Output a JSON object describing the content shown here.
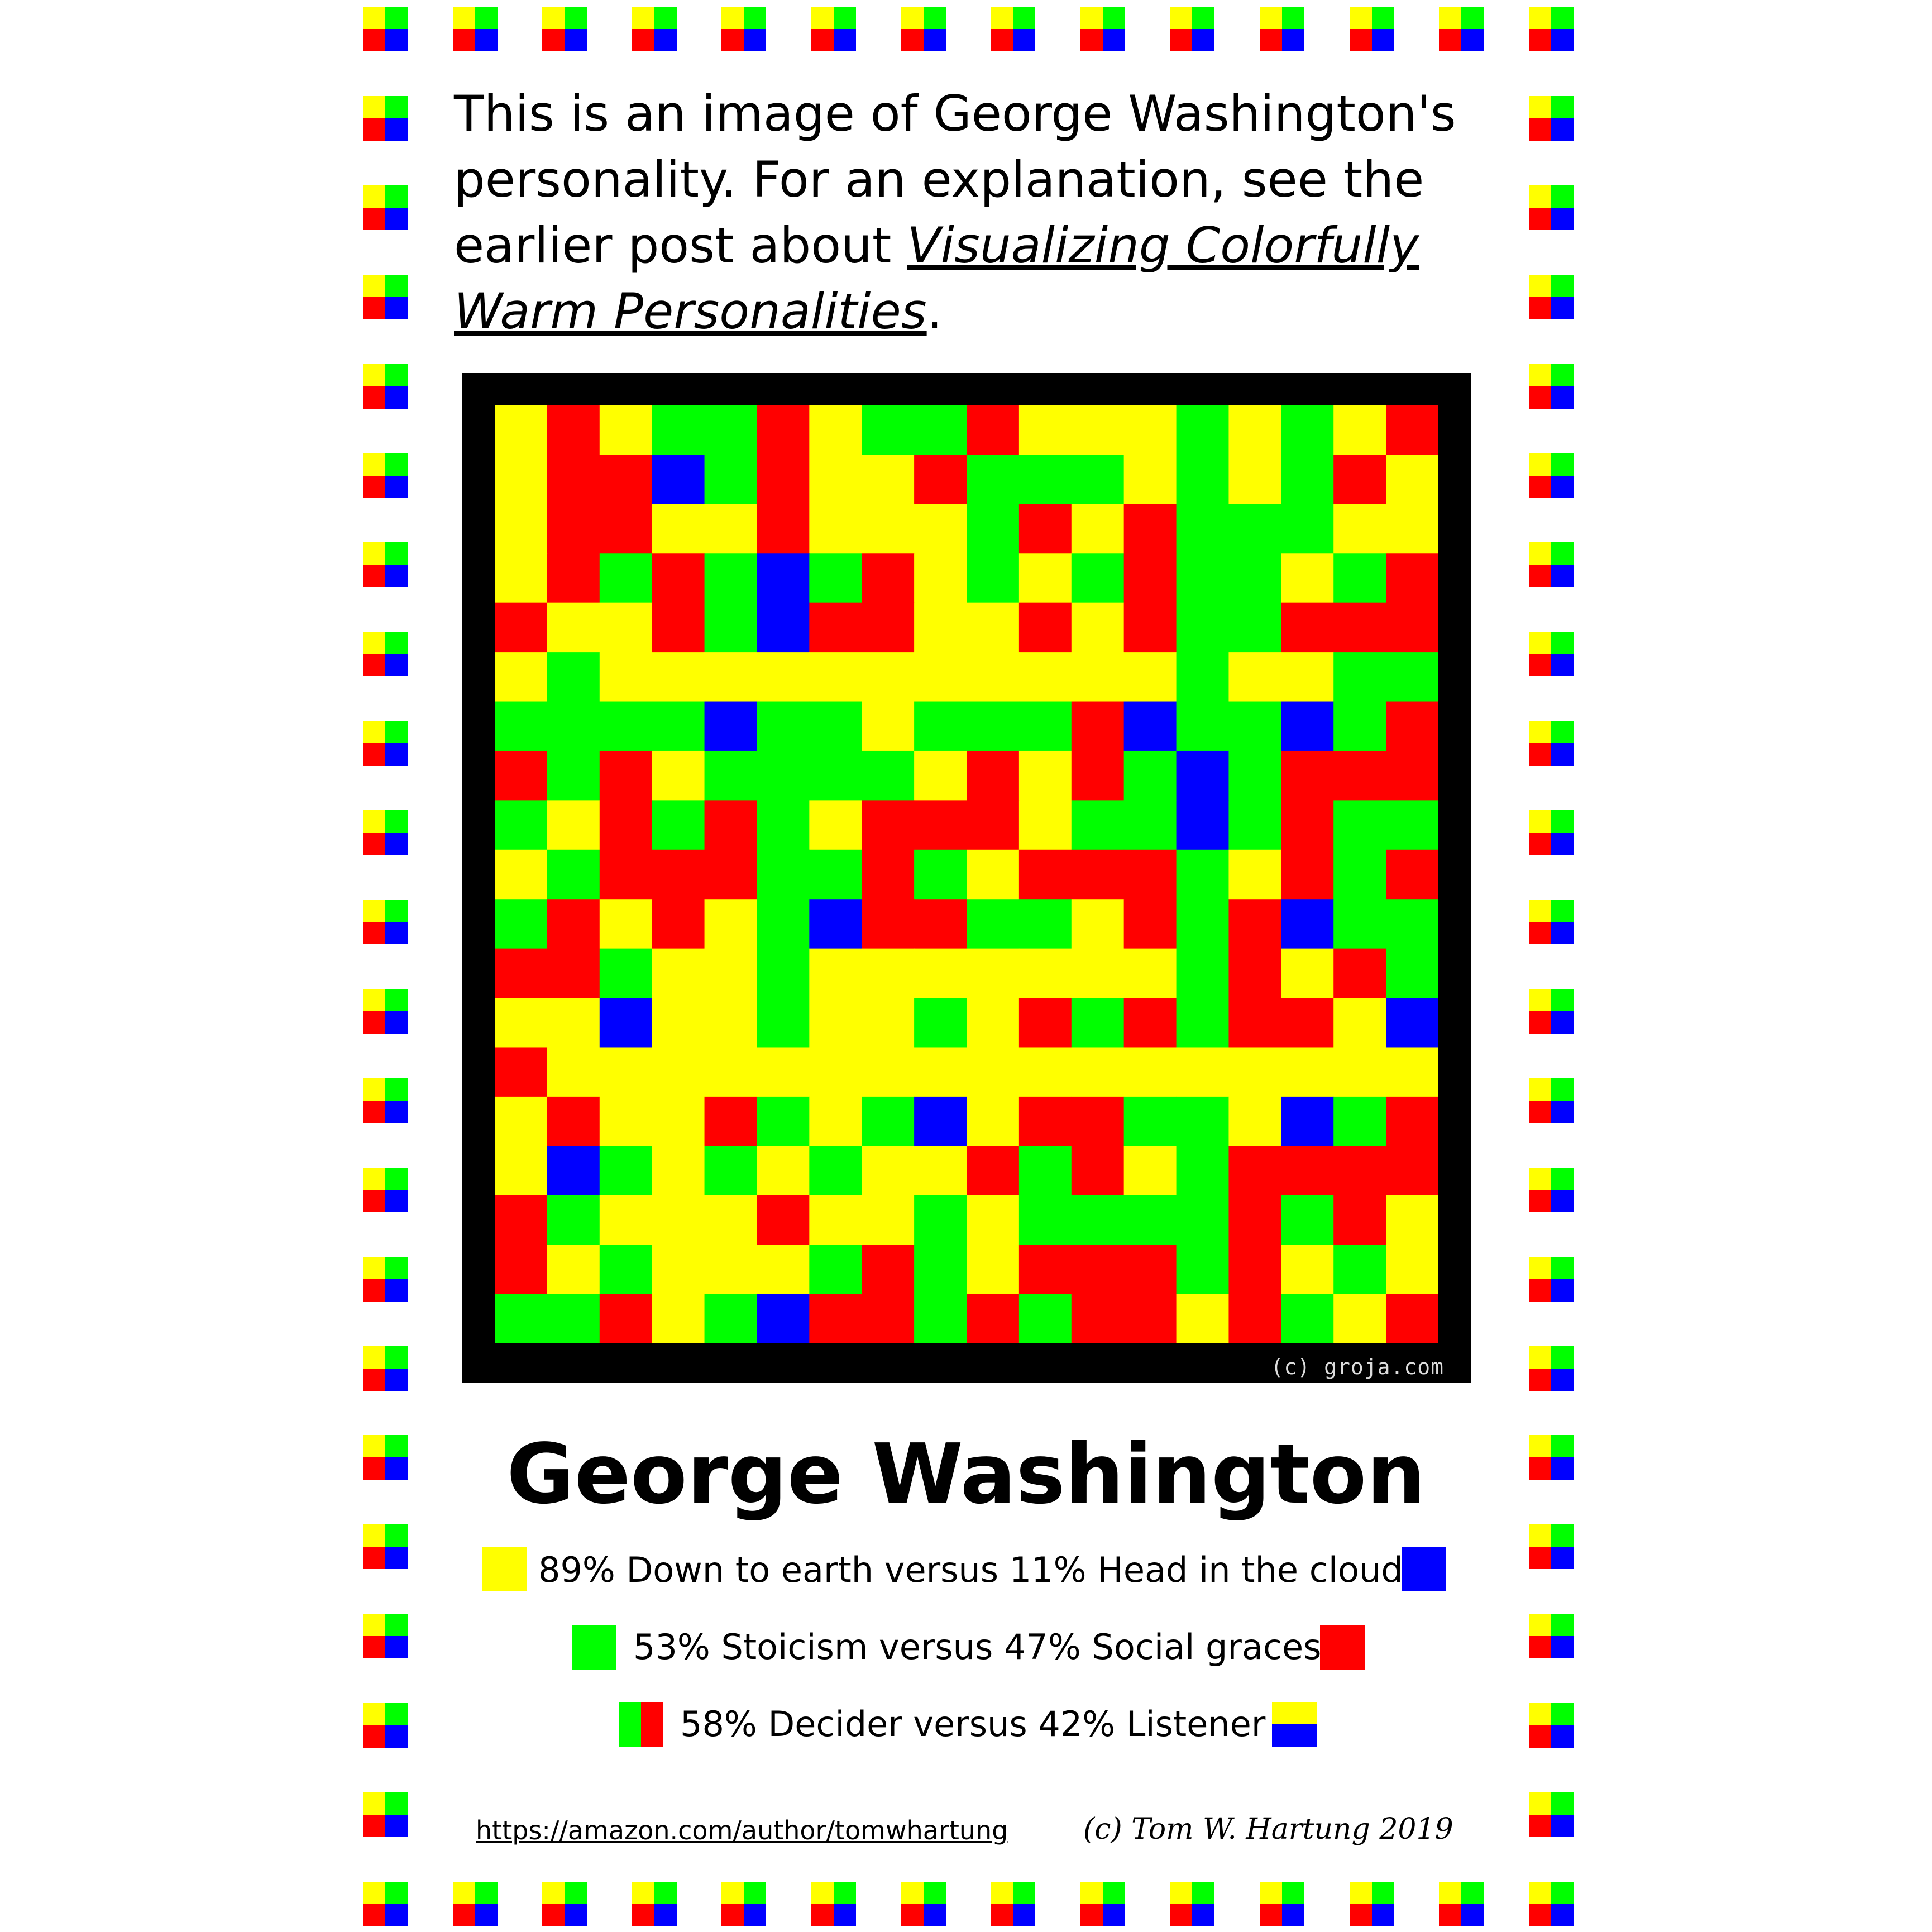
{
  "colors": {
    "yellow": "#ffff00",
    "blue": "#0000ff",
    "green": "#00ff00",
    "red": "#ff0000",
    "frame": "#000000"
  },
  "intro": {
    "text": "This is an image of George Washington's personality.  For an explanation, see the earlier post about ",
    "post_title": "Visualizing Colorfully Warm Personalities",
    "period": "."
  },
  "mosaic": {
    "watermark": "(c) groja.com",
    "rows": [
      "YRYGGRYGGRYYYGYGYR",
      "YRRBGRYYRGGGYGYGRY",
      "YRRYYRYYYGRYRGGGYY",
      "YRGRGBGRYGYGRGGYGR",
      "RYYRGBRRYYRYRGGRRR",
      "YGYYYYYYYYYYYGYYGG",
      "GGGGBGGYGGGRBGGBGR",
      "RGRYGGGGYRYRGBGRRR",
      "GYRGRGYRRRYGGBGRGG",
      "YGRRRGGRGYRRRGYRGR",
      "GRYRYGBRRGGYRGRBGG",
      "RRGYYGYYYYYYYGRYRG",
      "YYBYYGYYGYRGRGRRYB",
      "RYYYYYYYYYYYYYYYYY",
      "YRYYRGYGBYRRGGYBGR",
      "YBGYGYGYYRGRYGRRRR",
      "RGYYYRYYGYGGGGRGRY",
      "RYGYYYGRGYRRRGRYGY",
      "GGRYGBRRGRGRRYRGYR"
    ]
  },
  "person_name": "George Washington",
  "traits": [
    {
      "text": "89% Down to earth versus 11% Head in the clouds",
      "left": "yellow",
      "right": "blue"
    },
    {
      "text": "53% Stoicism versus 47% Social graces",
      "left": "green",
      "right": "red"
    },
    {
      "text": "58% Decider versus 42% Listener",
      "left": "green-red",
      "right": "yellow-blue"
    }
  ],
  "footer": {
    "link": "https://amazon.com/author/tomwhartung",
    "copyright": "(c) Tom W. Hartung 2019"
  }
}
